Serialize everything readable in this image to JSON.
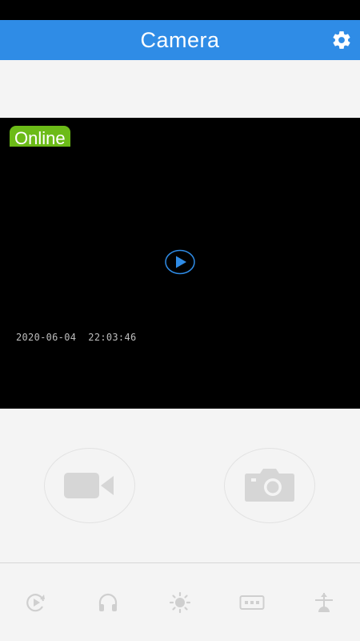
{
  "app_bar": {
    "title": "Camera",
    "settings_icon": "gear-icon"
  },
  "video": {
    "status": "Online",
    "timestamp": "2020-06-04  22:03:46",
    "play_icon": "play-icon"
  },
  "controls": {
    "record_icon": "video-camera-icon",
    "snapshot_icon": "camera-icon"
  },
  "toolbar": {
    "items": [
      {
        "icon": "replay-icon"
      },
      {
        "icon": "headphones-icon"
      },
      {
        "icon": "brightness-icon"
      },
      {
        "icon": "resolution-icon"
      },
      {
        "icon": "flip-icon"
      }
    ]
  },
  "colors": {
    "app_bar": "#2f8ce6",
    "online": "#6cbb18",
    "play": "#2f8ce6",
    "icon_gray": "#cfcfcf"
  }
}
